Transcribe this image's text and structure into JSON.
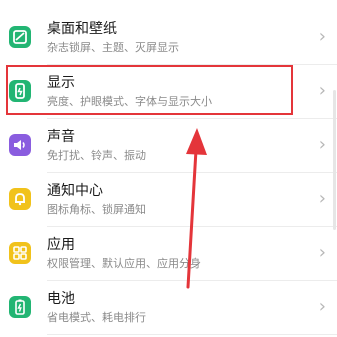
{
  "items": [
    {
      "title": "桌面和壁纸",
      "subtitle": "杂志锁屏、主题、灭屏显示",
      "icon": "wallpaper-icon",
      "color": "#22b573"
    },
    {
      "title": "显示",
      "subtitle": "亮度、护眼模式、字体与显示大小",
      "icon": "display-icon",
      "color": "#22b573"
    },
    {
      "title": "声音",
      "subtitle": "免打扰、铃声、振动",
      "icon": "sound-icon",
      "color": "#8a5ddf"
    },
    {
      "title": "通知中心",
      "subtitle": "图标角标、锁屏通知",
      "icon": "notification-bell-icon",
      "color": "#f1c21b"
    },
    {
      "title": "应用",
      "subtitle": "权限管理、默认应用、应用分身",
      "icon": "apps-grid-icon",
      "color": "#f1c21b"
    },
    {
      "title": "电池",
      "subtitle": "省电模式、耗电排行",
      "icon": "battery-icon",
      "color": "#22b573"
    }
  ],
  "chevron": "›",
  "annotation_color": "#e4353a"
}
